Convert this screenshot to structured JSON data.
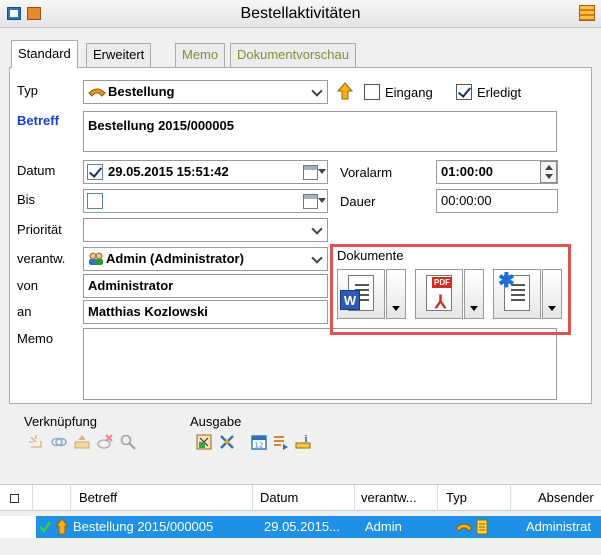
{
  "window": {
    "title": "Bestellaktivitäten"
  },
  "tabs": [
    {
      "label": "Standard"
    },
    {
      "label": "Erweitert"
    },
    {
      "label": "Memo"
    },
    {
      "label": "Dokumentvorschau"
    }
  ],
  "form": {
    "typ_label": "Typ",
    "typ_value": "Bestellung",
    "eingang_label": "Eingang",
    "eingang_checked": false,
    "erledigt_label": "Erledigt",
    "erledigt_checked": true,
    "betreff_label": "Betreff",
    "betreff_value": "Bestellung 2015/000005",
    "datum_label": "Datum",
    "datum_value": "29.05.2015 15:51:42",
    "datum_checked": true,
    "voralarm_label": "Voralarm",
    "voralarm_value": "01:00:00",
    "bis_label": "Bis",
    "bis_value": "",
    "bis_checked": false,
    "dauer_label": "Dauer",
    "dauer_value": "00:00:00",
    "prioritaet_label": "Priorität",
    "prioritaet_value": "",
    "verantw_label": "verantw.",
    "verantw_value": "Admin (Administrator)",
    "von_label": "von",
    "von_value": "Administrator",
    "an_label": "an",
    "an_value": "Matthias Kozlowski",
    "memo_label": "Memo",
    "memo_value": ""
  },
  "dokumente": {
    "label": "Dokumente",
    "word_badge": "W",
    "pdf_badge": "PDF",
    "buttons": [
      {
        "icon": "word-document-icon"
      },
      {
        "icon": "pdf-document-icon"
      },
      {
        "icon": "new-document-icon"
      }
    ]
  },
  "toolbar": {
    "verknuepfung_label": "Verknüpfung",
    "ausgabe_label": "Ausgabe"
  },
  "table": {
    "columns": [
      "Betreff",
      "Datum",
      "verantw...",
      "Typ",
      "Absender"
    ],
    "rows": [
      {
        "betreff": "Bestellung 2015/000005",
        "datum": "29.05.2015...",
        "verantw": "Admin",
        "absender": "Administrat"
      }
    ]
  },
  "colors": {
    "accent": "#1e90e6",
    "highlight_box": "#e05353",
    "label_blue": "#1a3fc8"
  }
}
